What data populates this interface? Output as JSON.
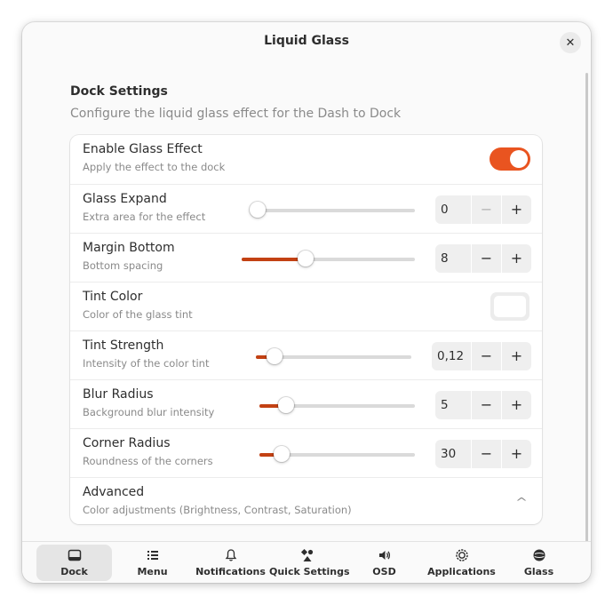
{
  "window": {
    "title": "Liquid Glass"
  },
  "section": {
    "title": "Dock Settings",
    "description": "Configure the liquid glass effect for the Dash to Dock"
  },
  "rows": {
    "enable": {
      "title": "Enable Glass Effect",
      "subtitle": "Apply the effect to the dock",
      "checked": true
    },
    "expand": {
      "title": "Glass Expand",
      "subtitle": "Extra area for the effect",
      "value": "0",
      "level": 0
    },
    "margin": {
      "title": "Margin Bottom",
      "subtitle": "Bottom spacing",
      "value": "8",
      "level": 0.37
    },
    "tint_color": {
      "title": "Tint Color",
      "subtitle": "Color of the glass tint",
      "color": "#ffffff"
    },
    "tint_strength": {
      "title": "Tint Strength",
      "subtitle": "Intensity of the color tint",
      "value": "0,12",
      "level": 0.12
    },
    "blur": {
      "title": "Blur Radius",
      "subtitle": "Background blur intensity",
      "value": "5",
      "level": 0.17
    },
    "corner": {
      "title": "Corner Radius",
      "subtitle": "Roundness of the corners",
      "value": "30",
      "level": 0.14
    },
    "advanced": {
      "title": "Advanced",
      "subtitle": "Color adjustments (Brightness, Contrast, Saturation)"
    }
  },
  "spin": {
    "minus": "−",
    "plus": "+"
  },
  "tabs": [
    {
      "label": "Dock",
      "icon": "dock-icon",
      "active": true
    },
    {
      "label": "Menu",
      "icon": "menu-list-icon"
    },
    {
      "label": "Notifications",
      "icon": "bell-icon"
    },
    {
      "label": "Quick Settings",
      "icon": "shapes-icon"
    },
    {
      "label": "OSD",
      "icon": "speaker-icon"
    },
    {
      "label": "Applications",
      "icon": "gear-circle-icon"
    },
    {
      "label": "Glass",
      "icon": "glass-sphere-icon"
    }
  ],
  "colors": {
    "accent": "#e95420",
    "slider_fill": "#c34113"
  }
}
